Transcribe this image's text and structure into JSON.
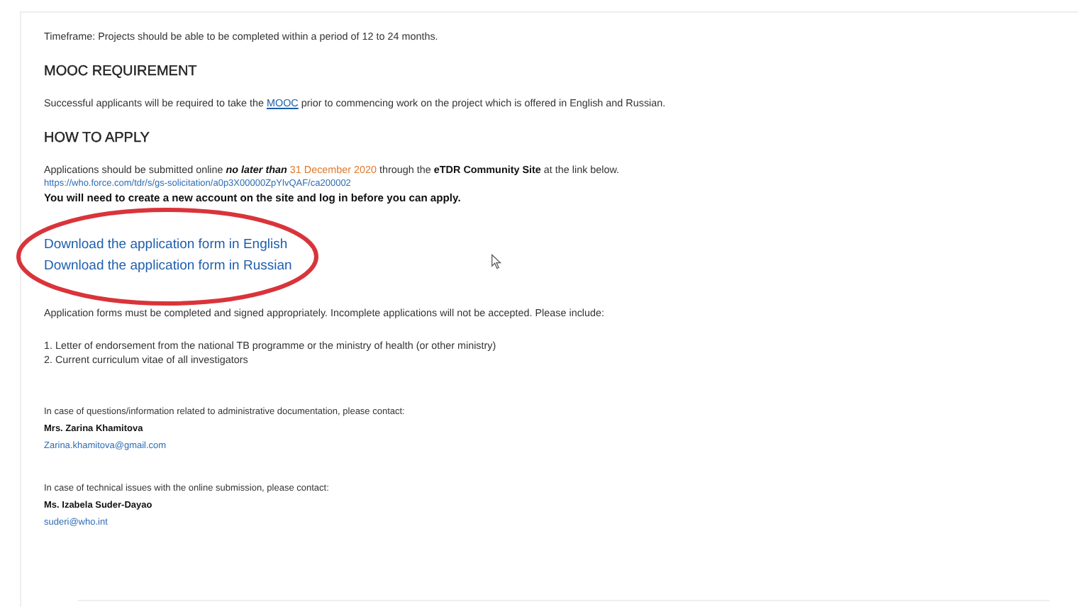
{
  "timeframe": "Timeframe: Projects should be able to be completed within a period of 12 to 24 months.",
  "mooc": {
    "heading": "MOOC REQUIREMENT",
    "parts": [
      {
        "kind": "plain",
        "text": "Successful applicants will be required to take the "
      },
      {
        "kind": "link",
        "text": "MOOC"
      },
      {
        "kind": "plain",
        "text": " prior to commencing work on the project which is offered in English and Russian."
      }
    ]
  },
  "apply": {
    "heading": "HOW TO APPLY",
    "parts": [
      {
        "kind": "plain",
        "text": "Applications should be submitted online "
      },
      {
        "kind": "emphasis",
        "text": "no later than"
      },
      {
        "kind": "date",
        "text": " 31 December 2020"
      },
      {
        "kind": "plain",
        "text": " through the "
      },
      {
        "kind": "bold",
        "text": "eTDR Community Site"
      },
      {
        "kind": "plain",
        "text": " at the link below."
      }
    ],
    "url": "https://who.force.com/tdr/s/gs-solicitation/a0p3X00000ZpYlvQAF/ca200002",
    "note": "You will need to create a new account on the site and log in before you can apply.",
    "downloads": [
      "Download the application form in English",
      "Download the application form in Russian"
    ],
    "requirements": "Application forms must be completed and signed appropriately. Incomplete applications will not be accepted. Please include:",
    "list": [
      "1. Letter of endorsement from the national TB programme or the ministry of health (or other ministry)",
      "2. Current curriculum vitae of all investigators"
    ]
  },
  "contacts": [
    {
      "intro": "In case of questions/information related to administrative documentation, please contact:",
      "name": "Mrs. Zarina Khamitova",
      "email": "Zarina.khamitova@gmail.com"
    },
    {
      "intro": "In case of technical issues with the online submission, please contact:",
      "name": "Ms. Izabela Suder-Dayao",
      "email": "suderi@who.int"
    }
  ]
}
